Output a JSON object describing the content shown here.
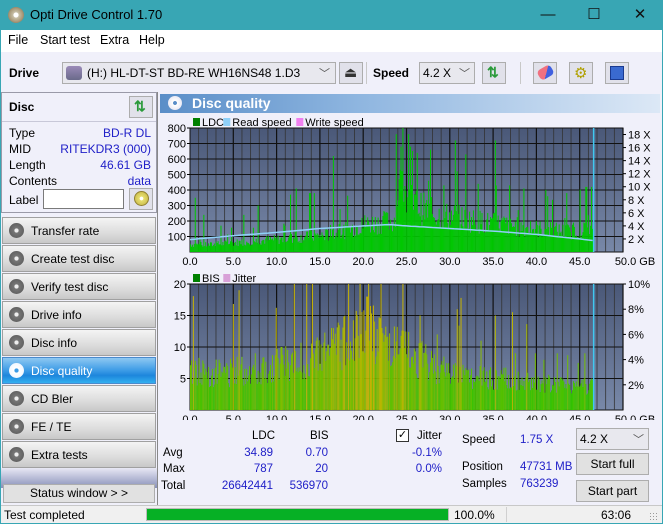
{
  "window": {
    "title": "Opti Drive Control 1.70",
    "controls": {
      "minimize": "—",
      "maximize": "☐",
      "close": "✕"
    }
  },
  "menu": [
    "File",
    "Start test",
    "Extra",
    "Help"
  ],
  "toolbar": {
    "drive_label": "Drive",
    "drive_value": "(H:)  HL-DT-ST BD-RE  WH16NS48 1.D3",
    "speed_label": "Speed",
    "speed_value": "4.2 X",
    "icons": [
      "eject-icon",
      "refresh-icon",
      "erase-icon",
      "settings-icon",
      "save-icon"
    ]
  },
  "disc": {
    "header": "Disc",
    "fields": [
      {
        "label": "Type",
        "value": "BD-R DL"
      },
      {
        "label": "MID",
        "value": "RITEKDR3 (000)"
      },
      {
        "label": "Length",
        "value": "46.61 GB"
      },
      {
        "label": "Contents",
        "value": "data"
      }
    ],
    "label_field": {
      "label": "Label",
      "value": ""
    }
  },
  "sidebar": {
    "items": [
      {
        "label": "Transfer rate",
        "active": false
      },
      {
        "label": "Create test disc",
        "active": false
      },
      {
        "label": "Verify test disc",
        "active": false
      },
      {
        "label": "Drive info",
        "active": false
      },
      {
        "label": "Disc info",
        "active": false
      },
      {
        "label": "Disc quality",
        "active": true
      },
      {
        "label": "CD Bler",
        "active": false
      },
      {
        "label": "FE / TE",
        "active": false
      },
      {
        "label": "Extra tests",
        "active": false
      }
    ],
    "status_window_button": "Status window > >"
  },
  "panel": {
    "title": "Disc quality"
  },
  "colors": {
    "ldc": "#00c800",
    "read_speed": "#8fd0f8",
    "write_speed": "#f080f0",
    "bis": "#00a000",
    "jitter": "#d8a0d8",
    "plot_bg_top": "#4a5878",
    "plot_bg_bottom": "#7888a8",
    "position_marker": "#40c8f0",
    "accent_value": "#2020c8",
    "progress": "#06b025"
  },
  "chart_data": [
    {
      "type": "bar",
      "title": "LDC / Read speed",
      "legend": [
        "LDC",
        "Read speed",
        "Write speed"
      ],
      "legend_placement": "top-left",
      "xlabel": "GB",
      "x_ticks": [
        "0.0",
        "5.0",
        "10.0",
        "15.0",
        "20.0",
        "25.0",
        "30.0",
        "35.0",
        "40.0",
        "45.0",
        "50.0 GB"
      ],
      "xlim": [
        0,
        50
      ],
      "y_ticks": [
        "100",
        "200",
        "300",
        "400",
        "500",
        "600",
        "700",
        "800"
      ],
      "ylim": [
        0,
        800
      ],
      "y2_ticks": [
        "2 X",
        "4 X",
        "6 X",
        "8 X",
        "10 X",
        "12 X",
        "14 X",
        "16 X",
        "18 X"
      ],
      "y2lim": [
        0,
        19
      ],
      "grid": true,
      "position_marker_gb": 46.61,
      "series": [
        {
          "name": "LDC (baseline)",
          "x": [
            0,
            2,
            4,
            6,
            8,
            10,
            12,
            14,
            16,
            18,
            20,
            22,
            23.5,
            24,
            26,
            28,
            30,
            32,
            34,
            36,
            38,
            40,
            42,
            44,
            46,
            46.6
          ],
          "values": [
            50,
            45,
            55,
            65,
            75,
            80,
            90,
            100,
            110,
            140,
            180,
            190,
            200,
            430,
            300,
            250,
            230,
            210,
            190,
            180,
            160,
            150,
            140,
            130,
            150,
            120
          ]
        },
        {
          "name": "LDC (peaks)",
          "x": [
            0.5,
            1.5,
            3.5,
            6.2,
            7.8,
            11.5,
            12.2,
            13.8,
            14.3,
            16.5,
            19.8,
            22.5,
            23.8,
            24.5,
            25.4,
            26.2,
            27.5,
            29.3,
            30.6,
            31.8,
            33.2,
            35.2,
            36.8,
            38.5,
            41.2,
            43.4,
            45.7,
            46.3
          ],
          "values": [
            350,
            240,
            170,
            240,
            300,
            370,
            410,
            380,
            380,
            300,
            220,
            250,
            760,
            620,
            680,
            640,
            460,
            430,
            720,
            630,
            440,
            720,
            430,
            410,
            360,
            380,
            420,
            420
          ]
        },
        {
          "name": "Read speed",
          "unit": "X",
          "x": [
            0,
            5,
            10,
            15,
            20,
            23,
            25,
            30,
            35,
            40,
            45,
            46.6
          ],
          "values": [
            1.9,
            2.5,
            3.0,
            3.6,
            4.0,
            4.2,
            4.0,
            3.6,
            3.2,
            2.7,
            2.0,
            1.75
          ]
        }
      ]
    },
    {
      "type": "bar",
      "title": "BIS / Jitter",
      "legend": [
        "BIS",
        "Jitter"
      ],
      "legend_placement": "top-left",
      "xlabel": "GB",
      "x_ticks": [
        "0.0",
        "5.0",
        "10.0",
        "15.0",
        "20.0",
        "25.0",
        "30.0",
        "35.0",
        "40.0",
        "45.0",
        "50.0 GB"
      ],
      "xlim": [
        0,
        50
      ],
      "y_ticks": [
        "5",
        "10",
        "15",
        "20"
      ],
      "ylim": [
        0,
        20
      ],
      "y2_ticks": [
        "2%",
        "4%",
        "6%",
        "8%",
        "10%"
      ],
      "y2lim": [
        0,
        10
      ],
      "grid": true,
      "position_marker_gb": 46.61,
      "series": [
        {
          "name": "BIS (baseline)",
          "x": [
            0,
            5,
            10,
            14,
            17,
            19,
            20,
            21,
            23,
            25,
            28,
            30,
            33,
            36,
            40,
            44,
            46.6
          ],
          "values": [
            6,
            6,
            7,
            8,
            10,
            12,
            14,
            12,
            10,
            9,
            7,
            6,
            5,
            5,
            4,
            4,
            4
          ]
        },
        {
          "name": "BIS (peaks)",
          "x": [
            0.3,
            3,
            7.5,
            10.5,
            14.5,
            16.5,
            18.3,
            19.6,
            20.4,
            22,
            24.5,
            26.5,
            28.5,
            30.8,
            33.5,
            35.2,
            37.5,
            39.8,
            42.3,
            45.5
          ],
          "values": [
            9,
            8,
            9,
            10,
            11,
            13,
            17,
            20,
            18,
            14,
            15,
            15,
            12,
            16,
            11,
            15,
            9,
            9,
            9,
            9
          ]
        }
      ]
    }
  ],
  "stats": {
    "headers": [
      "",
      "LDC",
      "BIS"
    ],
    "rows": [
      {
        "label": "Avg",
        "ldc": "34.89",
        "bis": "0.70",
        "jitter": "-0.1%"
      },
      {
        "label": "Max",
        "ldc": "787",
        "bis": "20",
        "jitter": "0.0%"
      },
      {
        "label": "Total",
        "ldc": "26642441",
        "bis": "536970",
        "jitter": ""
      }
    ],
    "jitter_label": "Jitter",
    "jitter_checked": true,
    "speed_label": "Speed",
    "speed_value": "1.75 X",
    "position_label": "Position",
    "position_value": "47731 MB",
    "samples_label": "Samples",
    "samples_value": "763239",
    "speed_select": "4.2 X",
    "start_full": "Start full",
    "start_part": "Start part"
  },
  "statusbar": {
    "text": "Test completed",
    "progress": 1.0,
    "progress_text": "100.0%",
    "time": "63:06"
  }
}
